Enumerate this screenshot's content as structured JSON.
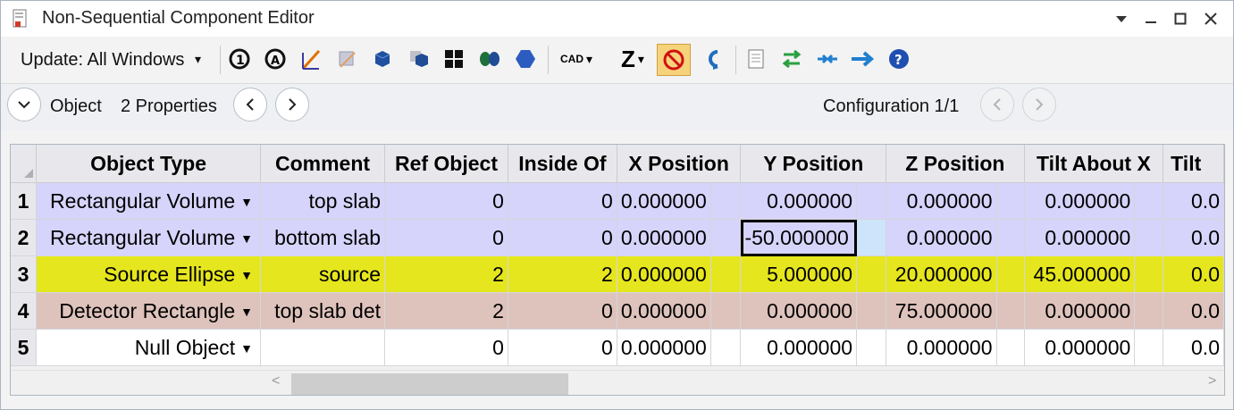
{
  "window": {
    "title": "Non-Sequential Component Editor"
  },
  "toolbar": {
    "update_label": "Update: All Windows",
    "cad_label": "CAD"
  },
  "navbar": {
    "object_label": "Object",
    "properties_label": "2 Properties",
    "configuration_label": "Configuration 1/1"
  },
  "grid": {
    "columns": [
      "Object Type",
      "Comment",
      "Ref Object",
      "Inside Of",
      "X Position",
      "Y Position",
      "Z Position",
      "Tilt About X",
      "Tilt"
    ],
    "rows": [
      {
        "num": "1",
        "type": "Rectangular Volume",
        "comment": "top slab",
        "ref": "0",
        "inside": "0",
        "x": "0.000000",
        "y": "0.000000",
        "z": "0.000000",
        "tiltx": "0.000000",
        "tilt": "0.0"
      },
      {
        "num": "2",
        "type": "Rectangular Volume",
        "comment": "bottom slab",
        "ref": "0",
        "inside": "0",
        "x": "0.000000",
        "y": "-50.000000",
        "z": "0.000000",
        "tiltx": "0.000000",
        "tilt": "0.0"
      },
      {
        "num": "3",
        "type": "Source Ellipse",
        "comment": "source",
        "ref": "2",
        "inside": "2",
        "x": "0.000000",
        "y": "5.000000",
        "z": "20.000000",
        "tiltx": "45.000000",
        "tilt": "0.0"
      },
      {
        "num": "4",
        "type": "Detector Rectangle",
        "comment": "top slab det",
        "ref": "2",
        "inside": "0",
        "x": "0.000000",
        "y": "0.000000",
        "z": "75.000000",
        "tiltx": "0.000000",
        "tilt": "0.0"
      },
      {
        "num": "5",
        "type": "Null Object",
        "comment": "",
        "ref": "0",
        "inside": "0",
        "x": "0.000000",
        "y": "0.000000",
        "z": "0.000000",
        "tiltx": "0.000000",
        "tilt": "0.0"
      }
    ],
    "row_colors": [
      "#d6d4fa",
      "#d6d4fa",
      "#e6e61e",
      "#dec3bc",
      "#ffffff"
    ],
    "selected_cell": "row 2, Y Position"
  }
}
